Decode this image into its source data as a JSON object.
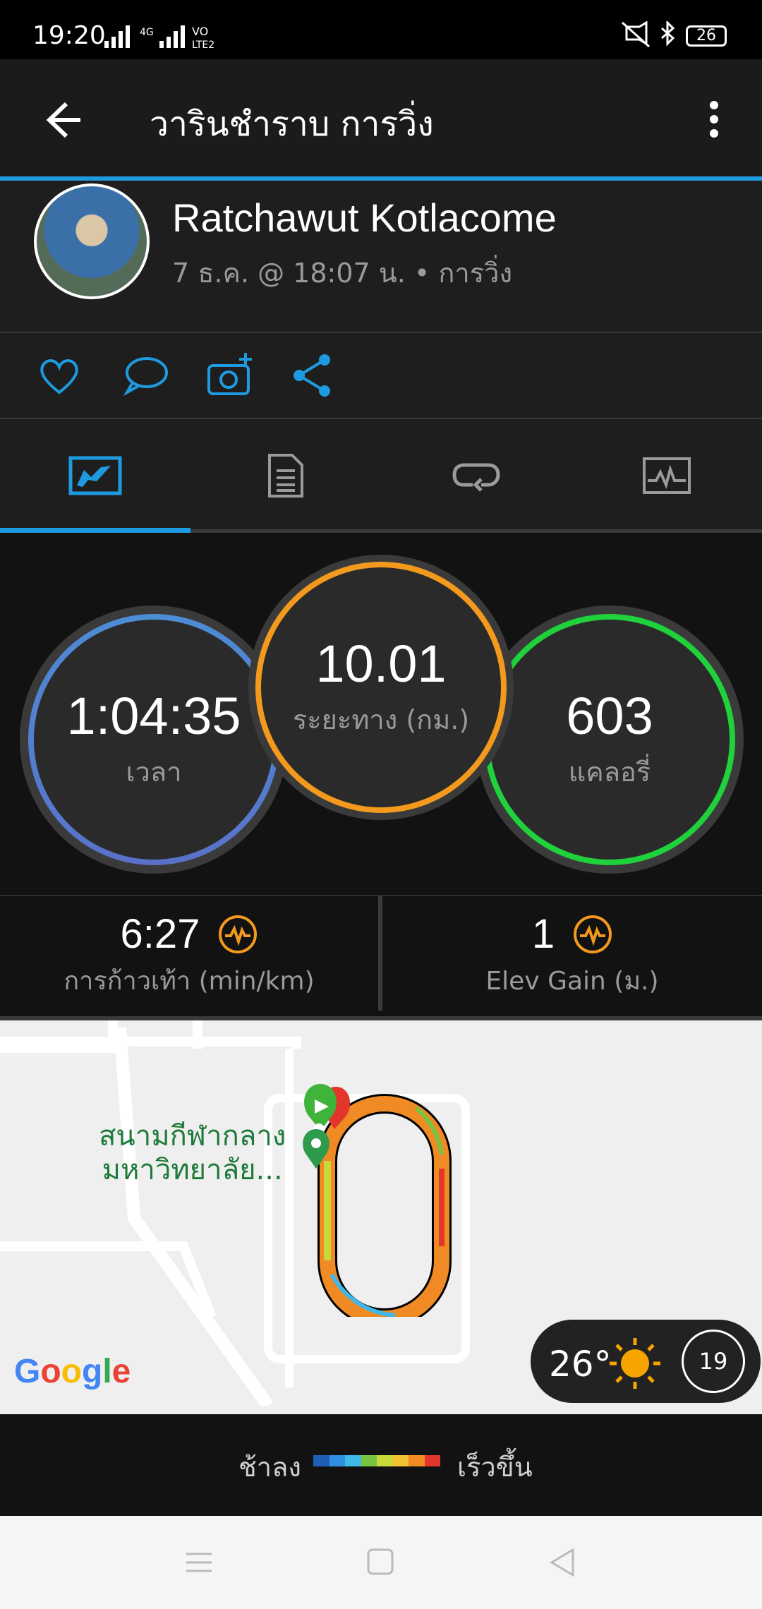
{
  "status": {
    "time": "19:20",
    "network": "4G",
    "volte": "VO LTE2",
    "battery": "26"
  },
  "header": {
    "title": "วารินชำราบ การวิ่ง"
  },
  "profile": {
    "name": "Ratchawut Kotlacome",
    "meta": "7 ธ.ค. @ 18:07 น. • การวิ่ง"
  },
  "actions": [
    "like-icon",
    "comment-icon",
    "add-photo-icon",
    "share-icon"
  ],
  "tabs": [
    "stats-tab",
    "details-tab",
    "laps-tab",
    "charts-tab"
  ],
  "stats": {
    "time": {
      "value": "1:04:35",
      "label": "เวลา"
    },
    "distance": {
      "value": "10.01",
      "label": "ระยะทาง (กม.)"
    },
    "calories": {
      "value": "603",
      "label": "แคลอรี่"
    },
    "pace": {
      "value": "6:27",
      "label": "การก้าวเท้า (min/km)"
    },
    "elev": {
      "value": "1",
      "label": "Elev Gain (ม.)"
    }
  },
  "colors": {
    "accent": "#1e9be0",
    "time_ring": "#4b8fd6",
    "distance_ring": "#f39a1e",
    "calories_ring": "#1fd13b"
  },
  "map": {
    "place_line1": "สนามกีฬากลาง",
    "place_line2": "มหาวิทยาลัย...",
    "google": "Google",
    "temperature": "26°",
    "wind": "19"
  },
  "legend": {
    "slow": "ช้าลง",
    "fast": "เร็วขึ้น",
    "colors": [
      "#1e5fb4",
      "#2f8fe0",
      "#3fb8e8",
      "#76c442",
      "#c8d83a",
      "#f1c232",
      "#f08a24",
      "#e2352b"
    ]
  }
}
